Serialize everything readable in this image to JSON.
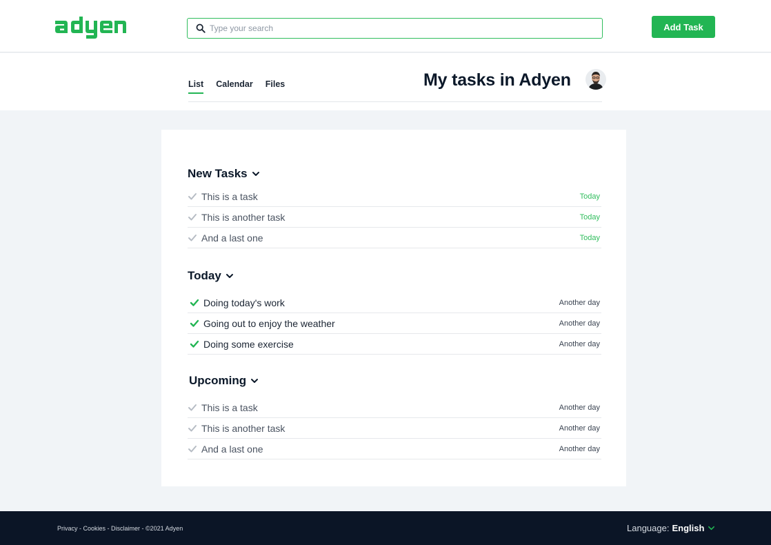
{
  "header": {
    "logo_text": "adyen",
    "search": {
      "placeholder": "Type your search",
      "value": ""
    },
    "add_task_label": "Add Task"
  },
  "subheader": {
    "tabs": [
      {
        "label": "List",
        "active": true
      },
      {
        "label": "Calendar",
        "active": false
      },
      {
        "label": "Files",
        "active": false
      }
    ],
    "title": "My tasks in Adyen"
  },
  "sections": [
    {
      "title": "New Tasks",
      "items": [
        {
          "label": "This is a task",
          "date": "Today",
          "done": false
        },
        {
          "label": "This is another task",
          "date": "Today",
          "done": false
        },
        {
          "label": "And a last one",
          "date": "Today",
          "done": false
        }
      ]
    },
    {
      "title": "Today",
      "items": [
        {
          "label": "Doing today's work",
          "date": "Another day",
          "done": true
        },
        {
          "label": "Going out to enjoy the weather",
          "date": "Another day",
          "done": true
        },
        {
          "label": "Doing some exercise",
          "date": "Another day",
          "done": true
        }
      ]
    },
    {
      "title": "Upcoming",
      "items": [
        {
          "label": "This is a task",
          "date": "Another day",
          "done": false
        },
        {
          "label": "This is another task",
          "date": "Another day",
          "done": false
        },
        {
          "label": "And a last one",
          "date": "Another day",
          "done": false
        }
      ]
    }
  ],
  "footer": {
    "links_text": "Privacy - Cookies - Disclaimer - ©2021 Adyen",
    "language_label": "Language:",
    "language_value": "English"
  },
  "colors": {
    "brand_green": "#22b553",
    "footer_bg": "#0b1526",
    "page_bg": "#f1f4f7"
  },
  "icons": [
    "adyen-logo",
    "search-icon",
    "avatar",
    "chevron-down-icon",
    "check-icon"
  ]
}
